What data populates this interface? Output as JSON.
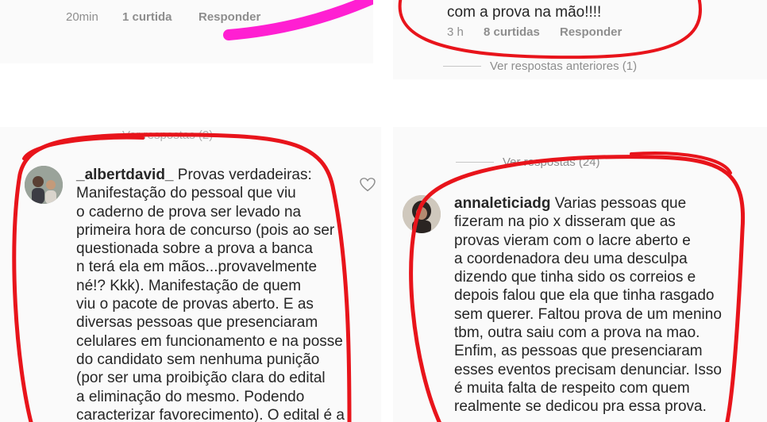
{
  "comment_top_left": {
    "time": "20min",
    "likes": "1 curtida",
    "reply": "Responder"
  },
  "comment_top_right": {
    "text_tail": "com a prova na mão!!!!",
    "time": "3 h",
    "likes": "8 curtidas",
    "reply": "Responder",
    "view_previous": "Ver respostas anteriores (1)"
  },
  "comment_left": {
    "view_replies": "Ver respostas (2)",
    "username": "_albertdavid_",
    "text": " Provas verdadeiras:\nManifestação do pessoal que viu\no caderno de prova ser levado na\nprimeira hora de concurso (pois ao ser\nquestionada sobre a prova a banca\nn terá ela em mãos...provavelmente\nné!? Kkk). Manifestação de quem\nviu o pacote de provas aberto. E as\ndiversas pessoas que presenciaram\ncelulares em funcionamento e na posse\ndo candidato sem nenhuma punição\n(por ser uma proibição clara do edital\na eliminação do mesmo. Podendo\ncaracterizar favorecimento). O edital é a\nlei. Foriu é possível de cancelamento"
  },
  "comment_right": {
    "view_replies": "Ver respostas (24)",
    "username": "annaleticiadg",
    "text": " Varias pessoas que\nfizeram na pio x disseram que as\nprovas vieram com o lacre aberto e\na coordenadora deu uma desculpa\ndizendo que tinha sido os correios e\ndepois falou que ela que tinha rasgado\nsem querer. Faltou prova de um menino\ntbm, outra saiu com a prova na mao.\nEnfim, as pessoas que presenciaram\nesses eventos precisam denunciar. Isso\né muita falta de respeito com quem\nrealmente se dedicou pra essa prova."
  },
  "colors": {
    "highlight_red": "#e8141b",
    "highlight_magenta": "#ff1fd2",
    "meta_gray": "#8e8e8e",
    "text_dark": "#262626"
  }
}
